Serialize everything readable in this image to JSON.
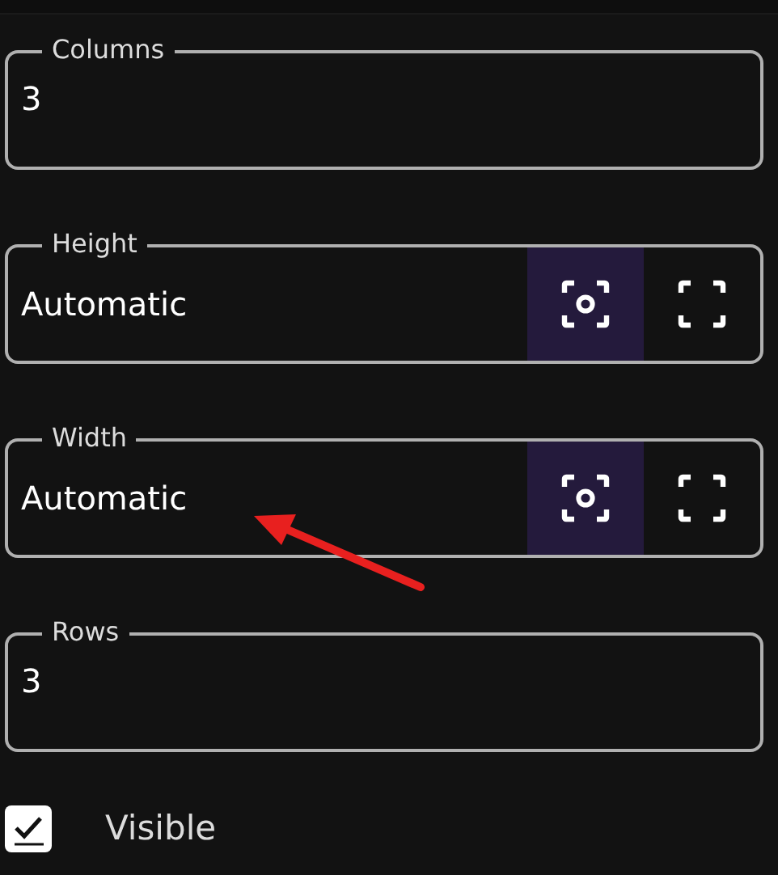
{
  "fields": [
    {
      "label": "Columns",
      "value": "3"
    },
    {
      "label": "Height",
      "value": "Automatic",
      "modes": [
        {
          "kind": "fit",
          "selected": true
        },
        {
          "kind": "fill",
          "selected": false
        }
      ]
    },
    {
      "label": "Width",
      "value": "Automatic",
      "modes": [
        {
          "kind": "fit",
          "selected": true
        },
        {
          "kind": "fill",
          "selected": false
        }
      ]
    },
    {
      "label": "Rows",
      "value": "3"
    }
  ],
  "visible": {
    "label": "Visible",
    "checked": true
  },
  "annotations": [
    {
      "kind": "arrow",
      "color": "#e8201f"
    }
  ]
}
